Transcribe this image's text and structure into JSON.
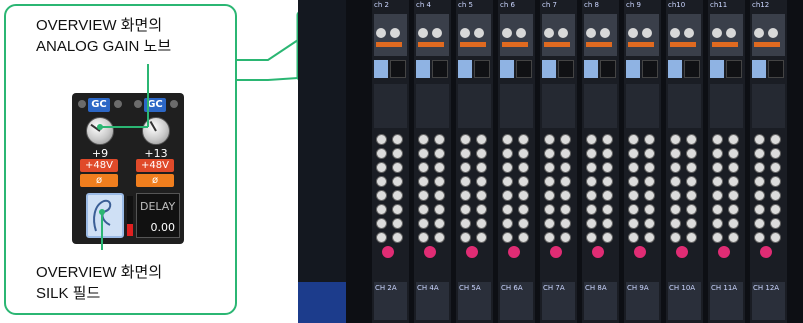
{
  "callout": {
    "label_knob": "OVERVIEW 화면의\nANALOG GAIN 노브",
    "label_silk": "OVERVIEW 화면의\nSILK 필드",
    "channels": [
      {
        "gc_label": "GC",
        "gain_value": "+9",
        "phantom_label": "+48V",
        "phase_label": "ø"
      },
      {
        "gc_label": "GC",
        "gain_value": "+13",
        "phantom_label": "+48V",
        "phase_label": "ø"
      }
    ],
    "delay_label": "DELAY",
    "delay_value": "0.00"
  },
  "mixer": {
    "strips": [
      {
        "name": "ch 2",
        "foot": "CH 2A"
      },
      {
        "name": "ch 4",
        "foot": "CH 4A"
      },
      {
        "name": "ch 5",
        "foot": "CH 5A"
      },
      {
        "name": "ch 6",
        "foot": "CH 6A"
      },
      {
        "name": "ch 7",
        "foot": "CH 7A"
      },
      {
        "name": "ch 8",
        "foot": "CH 8A"
      },
      {
        "name": "ch 9",
        "foot": "CH 9A"
      },
      {
        "name": "ch10",
        "foot": "CH 10A"
      },
      {
        "name": "ch11",
        "foot": "CH 11A"
      },
      {
        "name": "ch12",
        "foot": "CH 12A"
      }
    ]
  },
  "colors": {
    "callout_border": "#2bb673",
    "gc_blue": "#2c67c6",
    "phantom_red": "#e04a2a",
    "phase_orange": "#f07e1e",
    "mixer_bg": "#0d0f14"
  }
}
